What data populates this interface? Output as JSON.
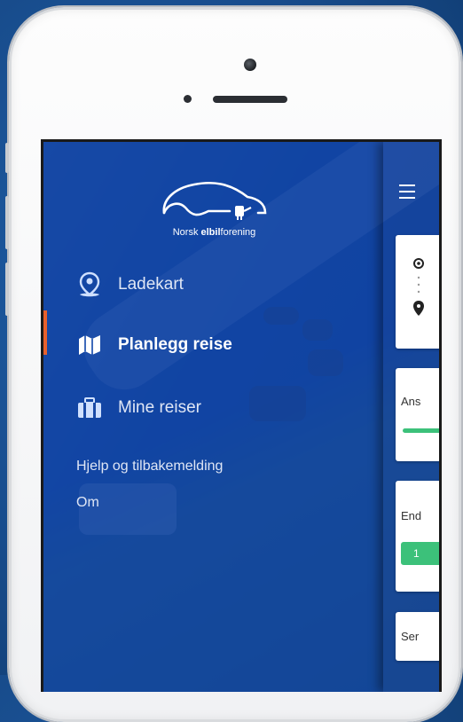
{
  "colors": {
    "accent": "#e8612c",
    "green": "#3cc17a",
    "drawer_blue": "#1046aa"
  },
  "brand": {
    "name_regular": "Norsk ",
    "name_bold": "elbil",
    "name_tail": "forening"
  },
  "menu": {
    "items": [
      {
        "label": "Ladekart",
        "icon": "map-pin-person-icon",
        "active": false
      },
      {
        "label": "Planlegg reise",
        "icon": "map-folded-icon",
        "active": true
      },
      {
        "label": "Mine reiser",
        "icon": "suitcase-icon",
        "active": false
      }
    ],
    "links": [
      "Hjelp og tilbakemelding",
      "Om"
    ]
  },
  "route_panel": {
    "cards": [
      {
        "label": "Ans"
      },
      {
        "label": "End",
        "button": "1"
      },
      {
        "label": "Ser"
      }
    ]
  }
}
